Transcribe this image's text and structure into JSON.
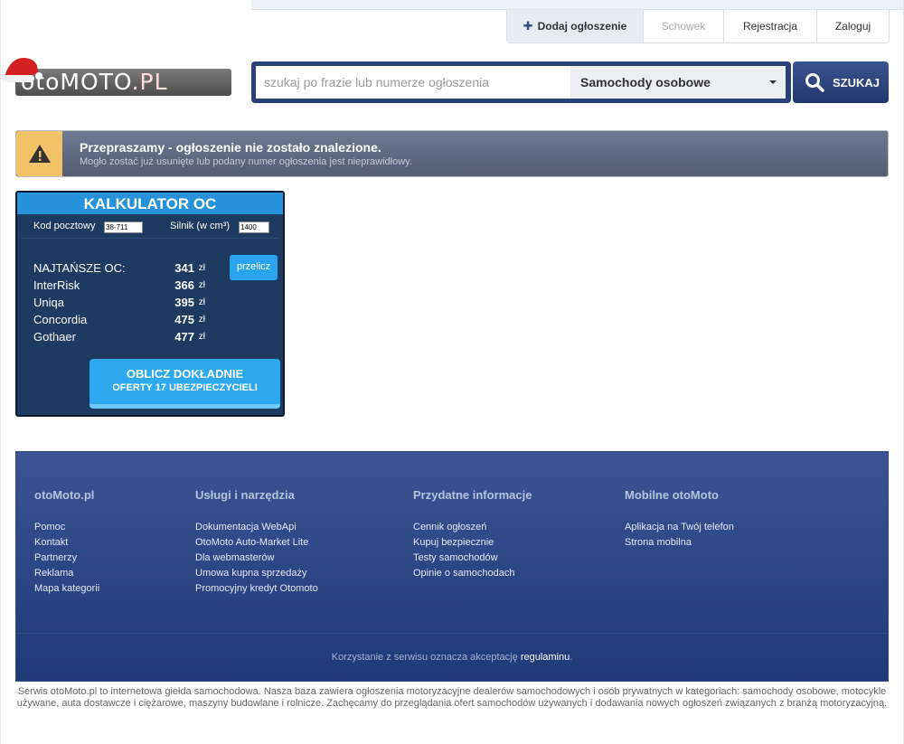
{
  "topnav": {
    "add_label": "Dodaj ogłoszenie",
    "fav_label": "Schowek",
    "register_label": "Rejestracja",
    "login_label": "Zaloguj"
  },
  "logo": {
    "text_main": "otoMOTO",
    "text_suffix": ".PL"
  },
  "search": {
    "placeholder": "szukaj po frazie lub numerze ogłoszenia",
    "category": "Samochody osobowe",
    "button_label": "SZUKAJ"
  },
  "alert": {
    "title": "Przepraszamy - ogłoszenie nie zostało znalezione.",
    "subtitle": "Mogło zostać już usunięte lub podany numer ogłoszenia jest nieprawidłowy."
  },
  "calculator": {
    "title": "KALKULATOR OC",
    "postal_label": "Kod pocztowy",
    "postal_value": "38-711",
    "engine_label": "Silnik (w cm³)",
    "engine_value": "1400",
    "recalc_label": "przelicz",
    "currency": "zł",
    "rows": [
      {
        "name": "NAJTAŃSZE OC:",
        "value": "341"
      },
      {
        "name": "InterRisk",
        "value": "366"
      },
      {
        "name": "Uniqa",
        "value": "395"
      },
      {
        "name": "Concordia",
        "value": "475"
      },
      {
        "name": "Gothaer",
        "value": "477"
      }
    ],
    "cta_line1": "OBLICZ DOKŁADNIE",
    "cta_line2": "OFERTY 17 UBEZPIECZYCIELI"
  },
  "footer": {
    "columns": [
      {
        "title": "otoMoto.pl",
        "links": [
          "Pomoc",
          "Kontakt",
          "Partnerzy",
          "Reklama",
          "Mapa kategorii"
        ]
      },
      {
        "title": "Usługi i narzędzia",
        "links": [
          "Dokumentacja WebApi",
          "OtoMoto Auto-Market Lite",
          "Dla webmasterów",
          "Umowa kupna sprzedaży",
          "Promocyjny kredyt Otomoto"
        ]
      },
      {
        "title": "Przydatne informacje",
        "links": [
          "Cennik ogłoszeń",
          "Kupuj bezpiecznie",
          "Testy samochodów",
          "Opinie o samochodach"
        ]
      },
      {
        "title": "Mobilne otoMoto",
        "links": [
          "Aplikacja na Twój telefon",
          "Strona mobilna"
        ]
      }
    ],
    "terms_text": "Korzystanie z serwisu oznacza akceptację",
    "terms_link": "regulaminu",
    "terms_dot": "."
  },
  "seo_text": "Serwis otoMoto.pl to internetowa giełda samochodowa. Nasza baza zawiera ogłoszenia motoryzacyjne dealerów samochodowych i osób prywatnych w kategoriach: samochody osobowe, motocykle używane, auta dostawcze i ciężarowe, maszyny budowlane i rolnicze. Zachęcamy do przeglądania ofert samochodów używanych i dodawania nowych ogłoszeń związanych z branżą motoryzacyjną.",
  "colors": {
    "brand_blue": "#2a4178",
    "calc_header": "#2692d9",
    "cta": "#2ea9ef",
    "warning": "#f1c267"
  }
}
